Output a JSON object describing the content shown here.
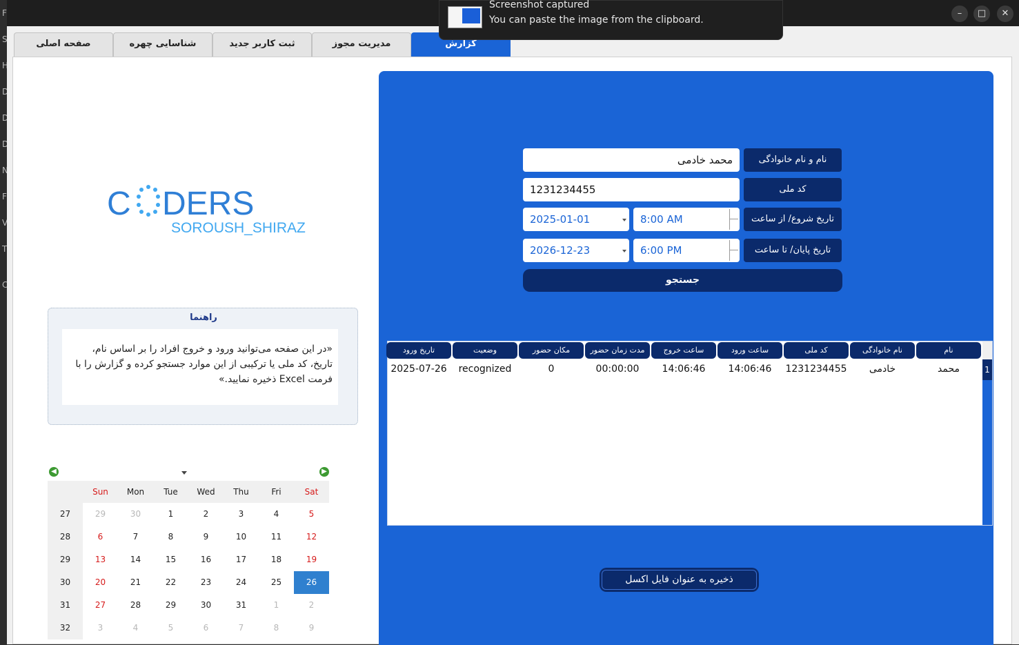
{
  "background_letters": [
    "F",
    "S",
    "H",
    "D",
    "D",
    "D",
    "N",
    "F",
    "V",
    "T",
    "C"
  ],
  "notification": {
    "title": "Screenshot captured",
    "body": "You can paste the image from the clipboard."
  },
  "window_controls": {
    "minimize": "–",
    "maximize": "□",
    "close": "✕"
  },
  "tabs": [
    {
      "label": "صفحه اصلی",
      "active": false
    },
    {
      "label": "شناسایی چهره",
      "active": false
    },
    {
      "label": "ثبت کاربر جدید",
      "active": false
    },
    {
      "label": "مدیریت مجوز",
      "active": false
    },
    {
      "label": "گزارش",
      "active": true
    }
  ],
  "logo": {
    "word_pre": "C",
    "word_post": "DERS",
    "sub": "SOROUSH_SHIRAZ"
  },
  "guide": {
    "title": "راهنما",
    "text": "«در این صفحه می‌توانید ورود و خروج افراد را بر اساس نام، تاریخ، کد ملی یا ترکیبی از این موارد جستجو کرده و گزارش را با فرمت Excel ذخیره نمایید.»"
  },
  "calendar": {
    "prev_icon": "◀",
    "next_icon": "▶",
    "headers": [
      "Sun",
      "Mon",
      "Tue",
      "Wed",
      "Thu",
      "Fri",
      "Sat"
    ],
    "weeks": [
      {
        "num": "27",
        "days": [
          {
            "d": "29",
            "m": true
          },
          {
            "d": "30",
            "m": true
          },
          {
            "d": "1"
          },
          {
            "d": "2"
          },
          {
            "d": "3"
          },
          {
            "d": "4"
          },
          {
            "d": "5",
            "r": true
          }
        ]
      },
      {
        "num": "28",
        "days": [
          {
            "d": "6",
            "r": true
          },
          {
            "d": "7"
          },
          {
            "d": "8"
          },
          {
            "d": "9"
          },
          {
            "d": "10"
          },
          {
            "d": "11"
          },
          {
            "d": "12",
            "r": true
          }
        ]
      },
      {
        "num": "29",
        "days": [
          {
            "d": "13",
            "r": true
          },
          {
            "d": "14"
          },
          {
            "d": "15"
          },
          {
            "d": "16"
          },
          {
            "d": "17"
          },
          {
            "d": "18"
          },
          {
            "d": "19",
            "r": true
          }
        ]
      },
      {
        "num": "30",
        "days": [
          {
            "d": "20",
            "r": true
          },
          {
            "d": "21"
          },
          {
            "d": "22"
          },
          {
            "d": "23"
          },
          {
            "d": "24"
          },
          {
            "d": "25"
          },
          {
            "d": "26",
            "s": true
          }
        ]
      },
      {
        "num": "31",
        "days": [
          {
            "d": "27",
            "r": true
          },
          {
            "d": "28"
          },
          {
            "d": "29"
          },
          {
            "d": "30"
          },
          {
            "d": "31"
          },
          {
            "d": "1",
            "m": true
          },
          {
            "d": "2",
            "m": true,
            "r": true
          }
        ]
      },
      {
        "num": "32",
        "days": [
          {
            "d": "3",
            "m": true,
            "r": true
          },
          {
            "d": "4",
            "m": true
          },
          {
            "d": "5",
            "m": true
          },
          {
            "d": "6",
            "m": true
          },
          {
            "d": "7",
            "m": true
          },
          {
            "d": "8",
            "m": true
          },
          {
            "d": "9",
            "m": true,
            "r": true
          }
        ]
      }
    ]
  },
  "form": {
    "name_label": "نام و نام خانوادگی",
    "name_value": "محمد خادمی",
    "nid_label": "کد ملی",
    "nid_value": "1231234455",
    "start_label": "تاریخ شروع/ از ساعت",
    "start_date": "2025-01-01",
    "start_time": "8:00 AM",
    "end_label": "تاریخ پایان/ تا ساعت",
    "end_date": "2026-12-23",
    "end_time": "6:00 PM",
    "search_label": "جستجو"
  },
  "table": {
    "columns": [
      "نام",
      "نام خانوادگی",
      "کد ملی",
      "ساعت ورود",
      "ساعت خروج",
      "مدت زمان حضور",
      "مکان حضور",
      "وضعیت",
      "تاریخ ورود"
    ],
    "rows": [
      {
        "index": "1",
        "cells": [
          "محمد",
          "خادمی",
          "1231234455",
          "14:06:46",
          "14:06:46",
          "00:00:00",
          "0",
          "recognized",
          "2025-07-26"
        ]
      }
    ]
  },
  "save_label": "ذخیره به عنوان فایل اکسل",
  "colors": {
    "accent": "#1a64d6",
    "dark": "#0b2a6b",
    "calendar_selected": "#2f80cf",
    "weekend": "#d61a1a"
  }
}
